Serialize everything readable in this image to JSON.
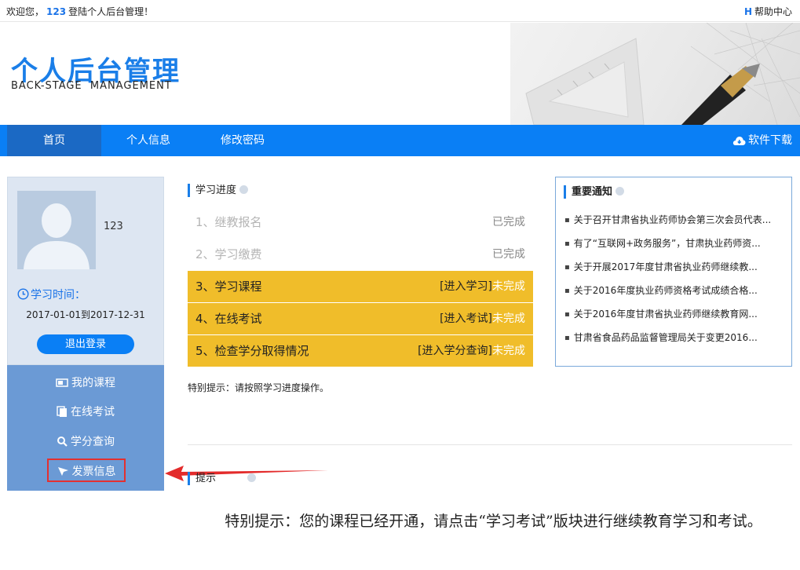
{
  "topbar": {
    "welcome_prefix": "欢迎您，",
    "username": "123",
    "welcome_suffix": "登陆个人后台管理！",
    "help_letter": "H",
    "help_label": "帮助中心"
  },
  "header": {
    "title": "个人后台管理",
    "subtitle": "BACK-STAGE  MANAGEMENT"
  },
  "nav": {
    "items": [
      {
        "label": "首页",
        "active": true
      },
      {
        "label": "个人信息",
        "active": false
      },
      {
        "label": "修改密码",
        "active": false
      }
    ],
    "download_label": "软件下载",
    "download_icon": "cloud-download-icon",
    "color": "#0a7ff5"
  },
  "profile": {
    "username": "123",
    "study_time_label": "学习时间：",
    "date_range": "2017-01-01到2017-12-31",
    "logout_label": "退出登录"
  },
  "menu": {
    "items": [
      {
        "label": "我的课程",
        "icon": "video-icon"
      },
      {
        "label": "在线考试",
        "icon": "exam-icon"
      },
      {
        "label": "学分查询",
        "icon": "search-icon"
      },
      {
        "label": "发票信息",
        "icon": "invoice-icon",
        "highlighted": true
      }
    ]
  },
  "progress": {
    "title": "学习进度",
    "steps": [
      {
        "label": "1、继教报名",
        "link": "",
        "status": "已完成",
        "done": true
      },
      {
        "label": "2、学习缴费",
        "link": "",
        "status": "已完成",
        "done": true
      },
      {
        "label": "3、学习课程",
        "link": "[进入学习]",
        "status": "未完成",
        "done": false
      },
      {
        "label": "4、在线考试",
        "link": "[进入考试]",
        "status": "未完成",
        "done": false
      },
      {
        "label": "5、检查学分取得情况",
        "link": "[进入学分查询]",
        "status": "未完成",
        "done": false
      }
    ],
    "tip": "特别提示：请按照学习进度操作。",
    "highlight_color": "#f0bd2a"
  },
  "notices": {
    "title": "重要通知",
    "items": [
      "关于召开甘肃省执业药师协会第三次会员代表...",
      "有了“互联网+政务服务”，甘肃执业药师资...",
      "关于开展2017年度甘肃省执业药师继续教...",
      "关于2016年度执业药师资格考试成绩合格...",
      "关于2016年度甘肃省执业药师继续教育网...",
      "甘肃省食品药品监督管理局关于变更2016..."
    ]
  },
  "hint": {
    "title": "提示",
    "text": "特别提示：您的课程已经开通，请点击“学习考试”版块进行继续教育学习和考试。"
  }
}
